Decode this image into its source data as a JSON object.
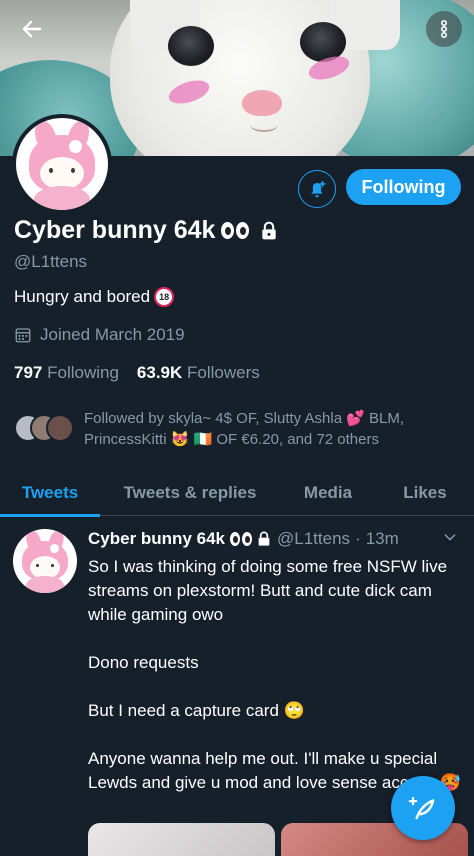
{
  "colors": {
    "accent": "#1da1f2",
    "background": "#15202b",
    "muted": "#8899a6"
  },
  "header": {
    "back_icon": "arrow-left-icon",
    "more_icon": "more-vertical-icon"
  },
  "profile": {
    "following_label": "Following",
    "notify_icon": "bell-plus-icon",
    "name": "Cyber bunny 64k",
    "handle": "@L1ttens",
    "bio": "Hungry and bored",
    "joined": "Joined March 2019",
    "following_count": "797",
    "following_label_text": "Following",
    "followers_count": "63.9K",
    "followers_label": "Followers",
    "followed_by_line1": "Followed by skyla~ 4$ OF, Slutty Ashla 💕 BLM,",
    "followed_by_line2": "PrincessKitti 😻 🇮🇪 OF €6.20, and 72 others"
  },
  "tabs": [
    {
      "label": "Tweets",
      "active": true
    },
    {
      "label": "Tweets & replies",
      "active": false
    },
    {
      "label": "Media",
      "active": false
    },
    {
      "label": "Likes",
      "active": false
    }
  ],
  "tweet": {
    "name": "Cyber bunny 64k",
    "handle": "@L1ttens",
    "time": "13m",
    "line1": "So I was thinking of doing some free NSFW live streams on plexstorm! Butt and cute dick cam while gaming owo",
    "line2": "Dono requests",
    "line3": "But I need a capture card 🙄",
    "line4": "Anyone wanna help me out. I'll make u special Lewds and give u mod and love sense access 🥵"
  },
  "fab": {
    "icon": "compose-tweet-icon"
  }
}
